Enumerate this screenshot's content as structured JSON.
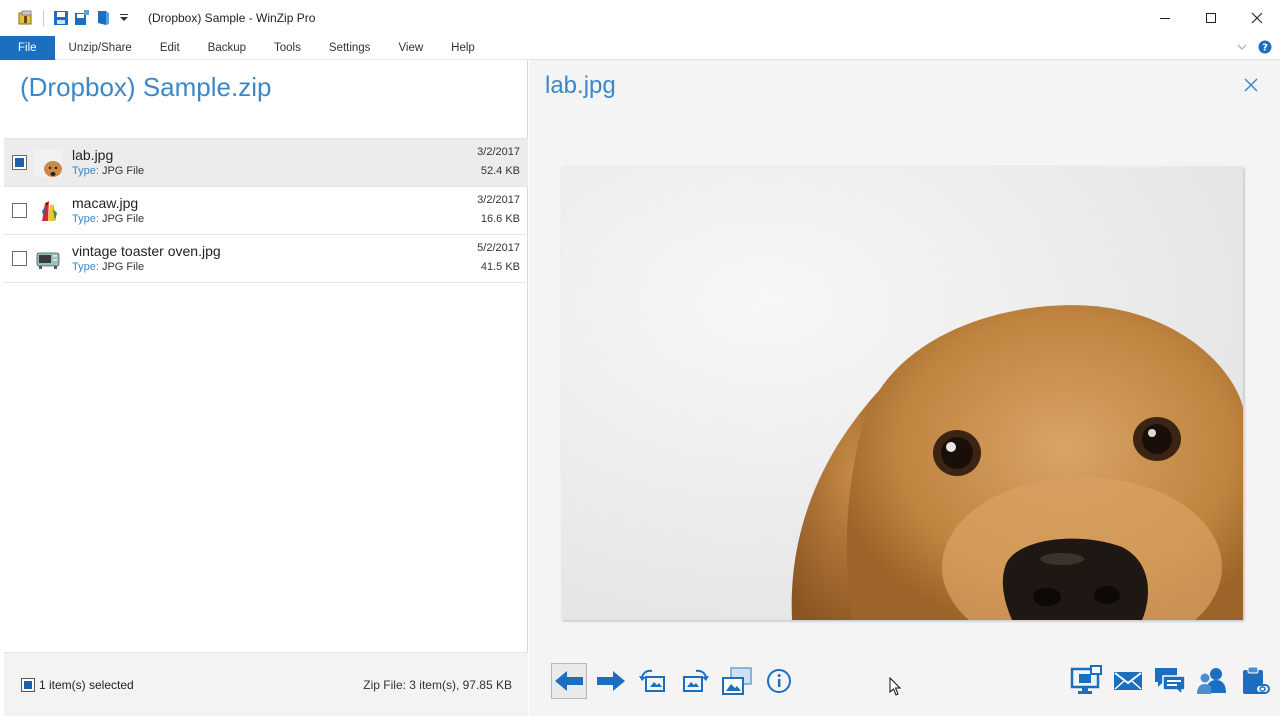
{
  "window": {
    "title": "(Dropbox) Sample - WinZip Pro",
    "minimize": "—",
    "maximize": "☐",
    "close": "✕"
  },
  "menu": {
    "items": [
      "File",
      "Unzip/Share",
      "Edit",
      "Backup",
      "Tools",
      "Settings",
      "View",
      "Help"
    ]
  },
  "archive": {
    "name": "(Dropbox) Sample.zip"
  },
  "files": [
    {
      "name": "lab.jpg",
      "type_label": "Type:",
      "type": "JPG File",
      "date": "3/2/2017",
      "size": "52.4 KB",
      "selected": true
    },
    {
      "name": "macaw.jpg",
      "type_label": "Type:",
      "type": "JPG File",
      "date": "3/2/2017",
      "size": "16.6 KB",
      "selected": false
    },
    {
      "name": "vintage toaster oven.jpg",
      "type_label": "Type:",
      "type": "JPG File",
      "date": "5/2/2017",
      "size": "41.5 KB",
      "selected": false
    }
  ],
  "status": {
    "selected": "1 item(s) selected",
    "zipinfo": "Zip File: 3 item(s), 97.85 KB"
  },
  "preview": {
    "title": "lab.jpg"
  },
  "toolbar": {
    "left": [
      "arrow-left-icon",
      "arrow-right-icon",
      "rotate-left-icon",
      "rotate-right-icon",
      "set-wallpaper-icon",
      "info-icon"
    ],
    "right": [
      "share-screen-icon",
      "email-icon",
      "im-share-icon",
      "contacts-icon",
      "clipboard-icon"
    ]
  },
  "colors": {
    "accent": "#3b88c8",
    "file_menu": "#1c6fc0",
    "icon_blue": "#1c6fc0"
  }
}
